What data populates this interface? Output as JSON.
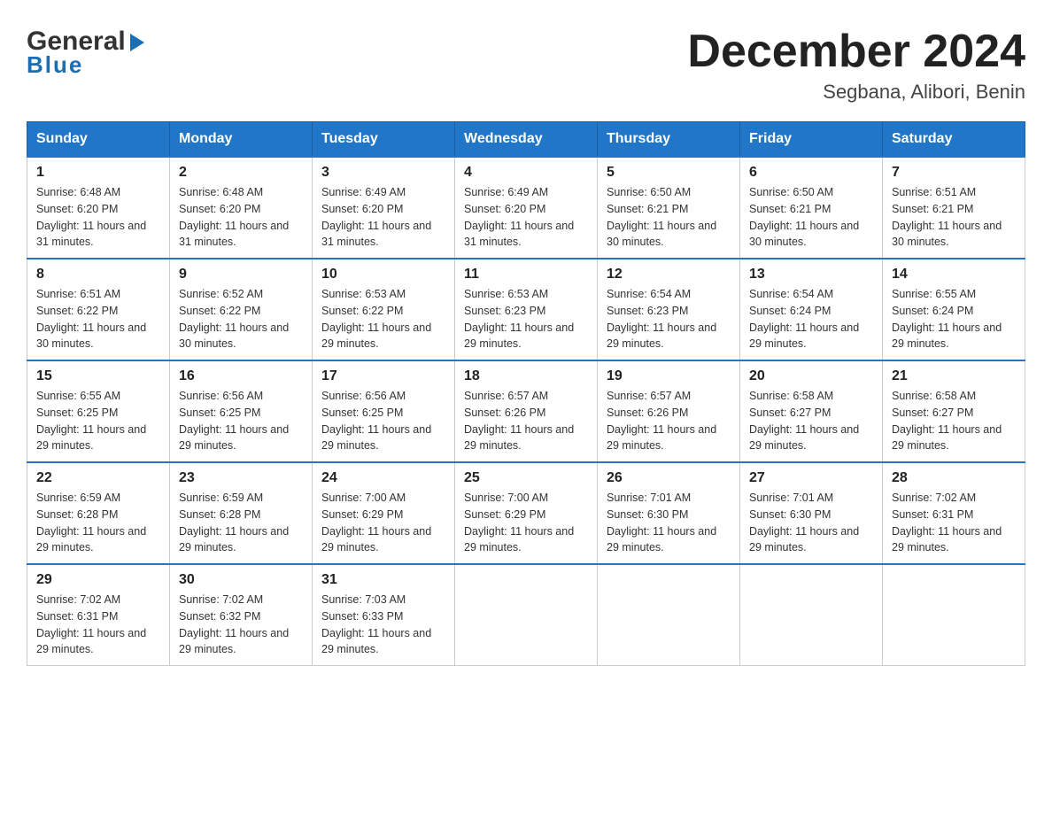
{
  "header": {
    "logo_general": "General",
    "logo_blue": "Blue",
    "title": "December 2024",
    "subtitle": "Segbana, Alibori, Benin"
  },
  "days_of_week": [
    "Sunday",
    "Monday",
    "Tuesday",
    "Wednesday",
    "Thursday",
    "Friday",
    "Saturday"
  ],
  "weeks": [
    [
      {
        "day": "1",
        "sunrise": "6:48 AM",
        "sunset": "6:20 PM",
        "daylight": "11 hours and 31 minutes."
      },
      {
        "day": "2",
        "sunrise": "6:48 AM",
        "sunset": "6:20 PM",
        "daylight": "11 hours and 31 minutes."
      },
      {
        "day": "3",
        "sunrise": "6:49 AM",
        "sunset": "6:20 PM",
        "daylight": "11 hours and 31 minutes."
      },
      {
        "day": "4",
        "sunrise": "6:49 AM",
        "sunset": "6:20 PM",
        "daylight": "11 hours and 31 minutes."
      },
      {
        "day": "5",
        "sunrise": "6:50 AM",
        "sunset": "6:21 PM",
        "daylight": "11 hours and 30 minutes."
      },
      {
        "day": "6",
        "sunrise": "6:50 AM",
        "sunset": "6:21 PM",
        "daylight": "11 hours and 30 minutes."
      },
      {
        "day": "7",
        "sunrise": "6:51 AM",
        "sunset": "6:21 PM",
        "daylight": "11 hours and 30 minutes."
      }
    ],
    [
      {
        "day": "8",
        "sunrise": "6:51 AM",
        "sunset": "6:22 PM",
        "daylight": "11 hours and 30 minutes."
      },
      {
        "day": "9",
        "sunrise": "6:52 AM",
        "sunset": "6:22 PM",
        "daylight": "11 hours and 30 minutes."
      },
      {
        "day": "10",
        "sunrise": "6:53 AM",
        "sunset": "6:22 PM",
        "daylight": "11 hours and 29 minutes."
      },
      {
        "day": "11",
        "sunrise": "6:53 AM",
        "sunset": "6:23 PM",
        "daylight": "11 hours and 29 minutes."
      },
      {
        "day": "12",
        "sunrise": "6:54 AM",
        "sunset": "6:23 PM",
        "daylight": "11 hours and 29 minutes."
      },
      {
        "day": "13",
        "sunrise": "6:54 AM",
        "sunset": "6:24 PM",
        "daylight": "11 hours and 29 minutes."
      },
      {
        "day": "14",
        "sunrise": "6:55 AM",
        "sunset": "6:24 PM",
        "daylight": "11 hours and 29 minutes."
      }
    ],
    [
      {
        "day": "15",
        "sunrise": "6:55 AM",
        "sunset": "6:25 PM",
        "daylight": "11 hours and 29 minutes."
      },
      {
        "day": "16",
        "sunrise": "6:56 AM",
        "sunset": "6:25 PM",
        "daylight": "11 hours and 29 minutes."
      },
      {
        "day": "17",
        "sunrise": "6:56 AM",
        "sunset": "6:25 PM",
        "daylight": "11 hours and 29 minutes."
      },
      {
        "day": "18",
        "sunrise": "6:57 AM",
        "sunset": "6:26 PM",
        "daylight": "11 hours and 29 minutes."
      },
      {
        "day": "19",
        "sunrise": "6:57 AM",
        "sunset": "6:26 PM",
        "daylight": "11 hours and 29 minutes."
      },
      {
        "day": "20",
        "sunrise": "6:58 AM",
        "sunset": "6:27 PM",
        "daylight": "11 hours and 29 minutes."
      },
      {
        "day": "21",
        "sunrise": "6:58 AM",
        "sunset": "6:27 PM",
        "daylight": "11 hours and 29 minutes."
      }
    ],
    [
      {
        "day": "22",
        "sunrise": "6:59 AM",
        "sunset": "6:28 PM",
        "daylight": "11 hours and 29 minutes."
      },
      {
        "day": "23",
        "sunrise": "6:59 AM",
        "sunset": "6:28 PM",
        "daylight": "11 hours and 29 minutes."
      },
      {
        "day": "24",
        "sunrise": "7:00 AM",
        "sunset": "6:29 PM",
        "daylight": "11 hours and 29 minutes."
      },
      {
        "day": "25",
        "sunrise": "7:00 AM",
        "sunset": "6:29 PM",
        "daylight": "11 hours and 29 minutes."
      },
      {
        "day": "26",
        "sunrise": "7:01 AM",
        "sunset": "6:30 PM",
        "daylight": "11 hours and 29 minutes."
      },
      {
        "day": "27",
        "sunrise": "7:01 AM",
        "sunset": "6:30 PM",
        "daylight": "11 hours and 29 minutes."
      },
      {
        "day": "28",
        "sunrise": "7:02 AM",
        "sunset": "6:31 PM",
        "daylight": "11 hours and 29 minutes."
      }
    ],
    [
      {
        "day": "29",
        "sunrise": "7:02 AM",
        "sunset": "6:31 PM",
        "daylight": "11 hours and 29 minutes."
      },
      {
        "day": "30",
        "sunrise": "7:02 AM",
        "sunset": "6:32 PM",
        "daylight": "11 hours and 29 minutes."
      },
      {
        "day": "31",
        "sunrise": "7:03 AM",
        "sunset": "6:33 PM",
        "daylight": "11 hours and 29 minutes."
      },
      null,
      null,
      null,
      null
    ]
  ]
}
